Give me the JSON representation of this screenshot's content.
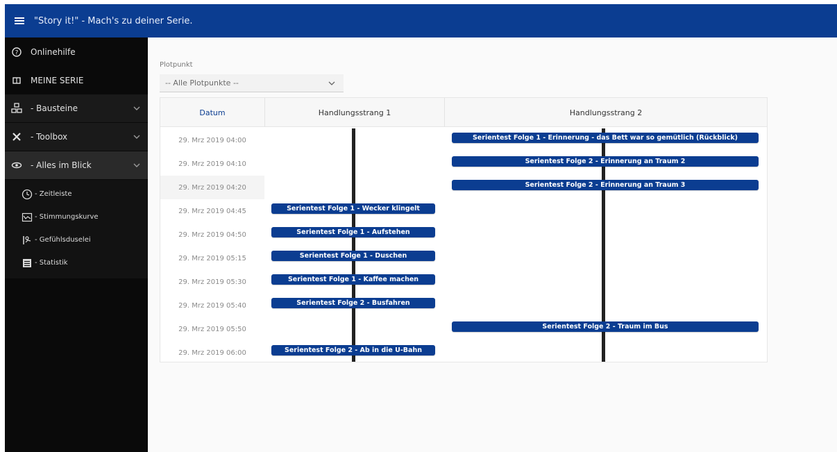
{
  "app": {
    "title": "\"Story it!\" - Mach's zu deiner Serie."
  },
  "colors": {
    "brand": "#0b3d91",
    "sidebar": "#0a0a0a",
    "pill": "#0b3d91"
  },
  "sidebar": {
    "items": [
      {
        "label": "Onlinehilfe",
        "icon": "help-circle-icon"
      },
      {
        "label": "MEINE SERIE",
        "icon": "book-icon"
      },
      {
        "label": "- Bausteine",
        "icon": "blocks-icon",
        "expandable": true
      },
      {
        "label": "- Toolbox",
        "icon": "tools-icon",
        "expandable": true
      },
      {
        "label": "- Alles im Blick",
        "icon": "eye-icon",
        "expandable": true,
        "open": true
      }
    ],
    "submenu": [
      {
        "label": "- Zeitleiste",
        "icon": "clock-icon"
      },
      {
        "label": "- Stimmungskurve",
        "icon": "chart-line-icon"
      },
      {
        "label": "- Gefühlsduselei",
        "icon": "emotion-icon"
      },
      {
        "label": "- Statistik",
        "icon": "statistics-icon"
      }
    ]
  },
  "filter": {
    "label": "Plotpunkt",
    "value": "-- Alle Plotpunkte --"
  },
  "table": {
    "headers": {
      "date": "Datum",
      "strand1": "Handlungsstrang 1",
      "strand2": "Handlungsstrang 2"
    },
    "rows": [
      {
        "date": "29. Mrz 2019 04:00",
        "strand1": "",
        "strand2": "Serientest Folge 1 - Erinnerung - das Bett war so gemütlich (Rückblick)"
      },
      {
        "date": "29. Mrz 2019 04:10",
        "strand1": "",
        "strand2": "Serientest Folge 2 - Erinnerung an Traum 2"
      },
      {
        "date": "29. Mrz 2019 04:20",
        "strand1": "",
        "strand2": "Serientest Folge 2 - Erinnerung an Traum 3"
      },
      {
        "date": "29. Mrz 2019 04:45",
        "strand1": "Serientest Folge 1 - Wecker klingelt",
        "strand2": ""
      },
      {
        "date": "29. Mrz 2019 04:50",
        "strand1": "Serientest Folge 1 - Aufstehen",
        "strand2": ""
      },
      {
        "date": "29. Mrz 2019 05:15",
        "strand1": "Serientest Folge 1 - Duschen",
        "strand2": ""
      },
      {
        "date": "29. Mrz 2019 05:30",
        "strand1": "Serientest Folge 1 - Kaffee machen",
        "strand2": ""
      },
      {
        "date": "29. Mrz 2019 05:40",
        "strand1": "Serientest Folge 2 - Busfahren",
        "strand2": ""
      },
      {
        "date": "29. Mrz 2019 05:50",
        "strand1": "",
        "strand2": "Serientest Folge 2 - Traum im Bus"
      },
      {
        "date": "29. Mrz 2019 06:00",
        "strand1": "Serientest Folge 2 - Ab in die U-Bahn",
        "strand2": ""
      }
    ]
  }
}
